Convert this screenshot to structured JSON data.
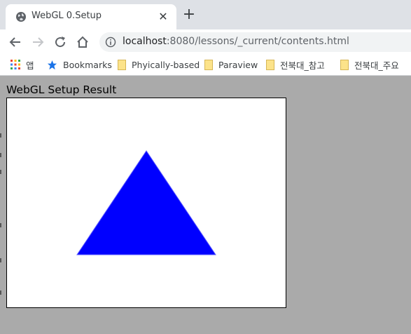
{
  "browser": {
    "tab_title": "WebGL 0.Setup",
    "close_glyph": "✕",
    "new_tab_glyph": "+",
    "url_host": "localhost",
    "url_rest": ":8080/lessons/_current/contents.html"
  },
  "bookmarks": {
    "items": [
      {
        "label": "앱",
        "icon": "apps-grid-icon"
      },
      {
        "label": "Bookmarks",
        "icon": "star-icon"
      },
      {
        "label": "Phyically-based",
        "icon": "folder-icon"
      },
      {
        "label": "Paraview",
        "icon": "folder-icon"
      },
      {
        "label": "전북대_참고",
        "icon": "folder-icon"
      },
      {
        "label": "전북대_주요",
        "icon": "folder-icon"
      }
    ]
  },
  "page": {
    "heading": "WebGL Setup Result"
  },
  "colors": {
    "page_background": "#aaaaaa",
    "triangle_fill": "#0000ff",
    "canvas_background": "#ffffff"
  }
}
